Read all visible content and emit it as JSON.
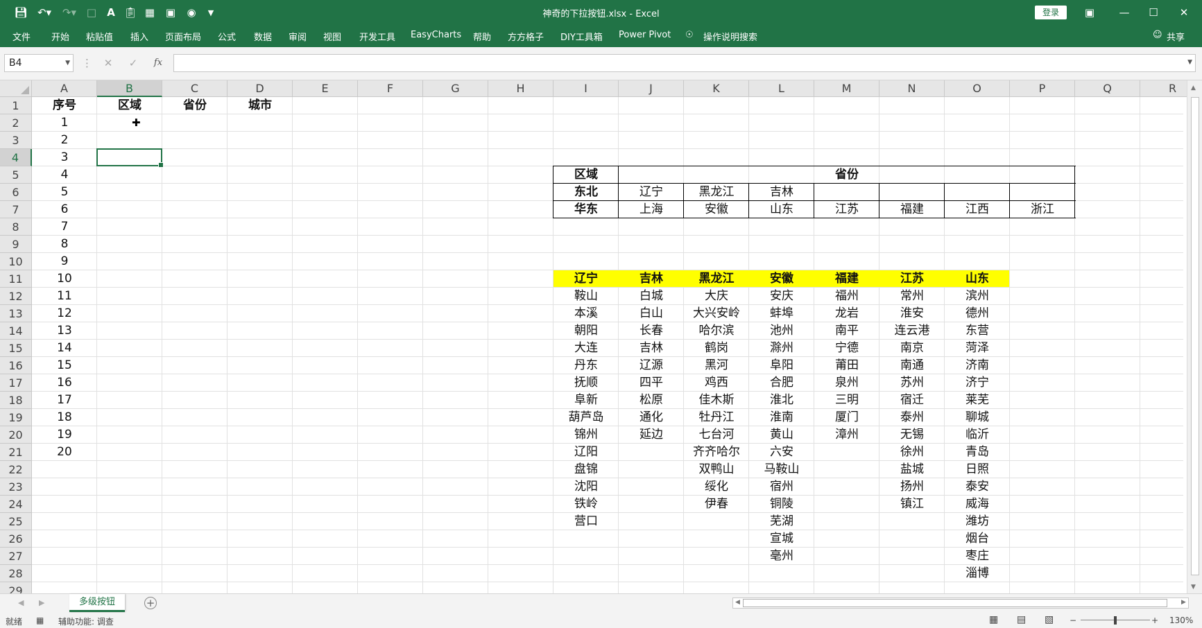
{
  "title_bar": {
    "title": "神奇的下拉按钮.xlsx  -  Excel",
    "login_label": "登录"
  },
  "ribbon": {
    "tabs": [
      "文件",
      "开始",
      "粘贴值",
      "插入",
      "页面布局",
      "公式",
      "数据",
      "审阅",
      "视图",
      "开发工具",
      "EasyCharts",
      "帮助",
      "方方格子",
      "DIY工具箱",
      "Power Pivot"
    ],
    "tell_me": "操作说明搜索",
    "share": "共享"
  },
  "formula_bar": {
    "name_box": "B4",
    "fx_label": "fx",
    "formula": ""
  },
  "columns": [
    "A",
    "B",
    "C",
    "D",
    "E",
    "F",
    "G",
    "H",
    "I",
    "J",
    "K",
    "L",
    "M",
    "N",
    "O",
    "P",
    "Q",
    "R"
  ],
  "rows": [
    "1",
    "2",
    "3",
    "4",
    "5",
    "6",
    "7",
    "8",
    "9",
    "10",
    "11",
    "12",
    "13",
    "14",
    "15",
    "16",
    "17",
    "18",
    "19",
    "20",
    "21",
    "22",
    "23",
    "24",
    "25",
    "26",
    "27",
    "28",
    "29"
  ],
  "sheet": {
    "headers": [
      "序号",
      "区域",
      "省份",
      "城市"
    ],
    "sequence": [
      "1",
      "2",
      "3",
      "4",
      "5",
      "6",
      "7",
      "8",
      "9",
      "10",
      "11",
      "12",
      "13",
      "14",
      "15",
      "16",
      "17",
      "18",
      "19",
      "20"
    ],
    "region_table": {
      "header_region": "区域",
      "header_province": "省份",
      "rows": [
        {
          "region": "东北",
          "provinces": [
            "辽宁",
            "黑龙江",
            "吉林",
            "",
            "",
            "",
            ""
          ]
        },
        {
          "region": "华东",
          "provinces": [
            "上海",
            "安徽",
            "山东",
            "江苏",
            "福建",
            "江西",
            "浙江"
          ]
        }
      ]
    },
    "city_table": {
      "headers": [
        "辽宁",
        "吉林",
        "黑龙江",
        "安徽",
        "福建",
        "江苏",
        "山东"
      ],
      "columns": [
        [
          "鞍山",
          "本溪",
          "朝阳",
          "大连",
          "丹东",
          "抚顺",
          "阜新",
          "葫芦岛",
          "锦州",
          "辽阳",
          "盘锦",
          "沈阳",
          "铁岭",
          "营口"
        ],
        [
          "白城",
          "白山",
          "长春",
          "吉林",
          "辽源",
          "四平",
          "松原",
          "通化",
          "延边"
        ],
        [
          "大庆",
          "大兴安岭",
          "哈尔滨",
          "鹤岗",
          "黑河",
          "鸡西",
          "佳木斯",
          "牡丹江",
          "七台河",
          "齐齐哈尔",
          "双鸭山",
          "绥化",
          "伊春"
        ],
        [
          "安庆",
          "蚌埠",
          "池州",
          "滁州",
          "阜阳",
          "合肥",
          "淮北",
          "淮南",
          "黄山",
          "六安",
          "马鞍山",
          "宿州",
          "铜陵",
          "芜湖",
          "宣城",
          "亳州"
        ],
        [
          "福州",
          "龙岩",
          "南平",
          "宁德",
          "莆田",
          "泉州",
          "三明",
          "厦门",
          "漳州"
        ],
        [
          "常州",
          "淮安",
          "连云港",
          "南京",
          "南通",
          "苏州",
          "宿迁",
          "泰州",
          "无锡",
          "徐州",
          "盐城",
          "扬州",
          "镇江"
        ],
        [
          "滨州",
          "德州",
          "东营",
          "菏泽",
          "济南",
          "济宁",
          "莱芜",
          "聊城",
          "临沂",
          "青岛",
          "日照",
          "泰安",
          "威海",
          "潍坊",
          "烟台",
          "枣庄",
          "淄博"
        ]
      ]
    },
    "header_fill": "#ffff00"
  },
  "sheet_tabs": [
    "多级按钮"
  ],
  "status_bar": {
    "ready": "就绪",
    "accessibility": "辅助功能: 调查",
    "zoom": "130%"
  },
  "colors": {
    "excel_green": "#217346",
    "highlight_yellow": "#ffff00"
  }
}
